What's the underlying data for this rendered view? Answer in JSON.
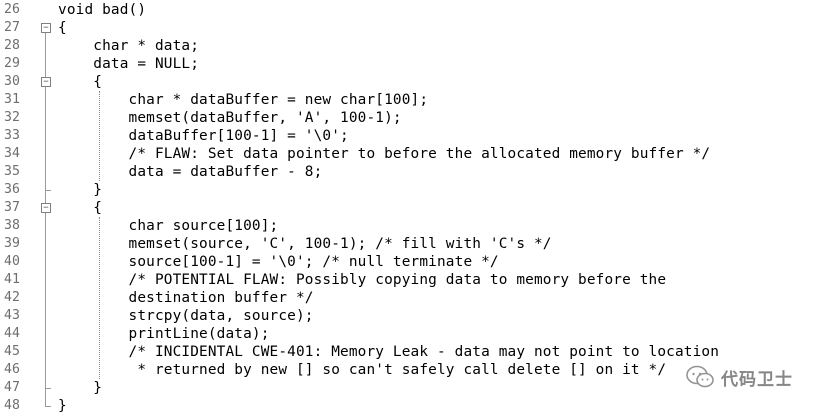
{
  "editor": {
    "lines": [
      {
        "num": "26",
        "code": "void bad()"
      },
      {
        "num": "27",
        "code": "{"
      },
      {
        "num": "28",
        "code": "    char * data;"
      },
      {
        "num": "29",
        "code": "    data = NULL;"
      },
      {
        "num": "30",
        "code": "    {"
      },
      {
        "num": "31",
        "code": "        char * dataBuffer = new char[100];"
      },
      {
        "num": "32",
        "code": "        memset(dataBuffer, 'A', 100-1);"
      },
      {
        "num": "33",
        "code": "        dataBuffer[100-1] = '\\0';"
      },
      {
        "num": "34",
        "code": "        /* FLAW: Set data pointer to before the allocated memory buffer */"
      },
      {
        "num": "35",
        "code": "        data = dataBuffer - 8;"
      },
      {
        "num": "36",
        "code": "    }"
      },
      {
        "num": "37",
        "code": "    {"
      },
      {
        "num": "38",
        "code": "        char source[100];"
      },
      {
        "num": "39",
        "code": "        memset(source, 'C', 100-1); /* fill with 'C's */"
      },
      {
        "num": "40",
        "code": "        source[100-1] = '\\0'; /* null terminate */"
      },
      {
        "num": "41",
        "code": "        /* POTENTIAL FLAW: Possibly copying data to memory before the"
      },
      {
        "num": "42",
        "code": "        destination buffer */"
      },
      {
        "num": "43",
        "code": "        strcpy(data, source);"
      },
      {
        "num": "44",
        "code": "        printLine(data);"
      },
      {
        "num": "45",
        "code": "        /* INCIDENTAL CWE-401: Memory Leak - data may not point to location"
      },
      {
        "num": "46",
        "code": "         * returned by new [] so can't safely call delete [] on it */"
      },
      {
        "num": "47",
        "code": "    }"
      },
      {
        "num": "48",
        "code": "}"
      }
    ],
    "fold_markers": [
      {
        "line_index": 1,
        "symbol": "−"
      },
      {
        "line_index": 4,
        "symbol": "−"
      },
      {
        "line_index": 11,
        "symbol": "−"
      }
    ]
  },
  "watermark": {
    "text": "代码卫士",
    "icon": "wechat-icon"
  },
  "colors": {
    "line_number": "#6e6e6e",
    "code_text": "#000000",
    "background": "#ffffff",
    "fold_line": "#9a9a9a"
  }
}
